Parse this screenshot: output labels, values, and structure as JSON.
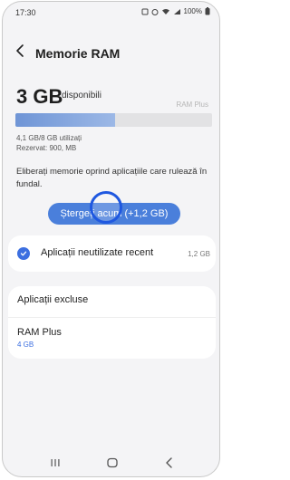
{
  "status": {
    "time": "17:30",
    "battery": "100%"
  },
  "header": {
    "title": "Memorie RAM"
  },
  "ram": {
    "available_value": "3 GB",
    "available_label": "disponibili",
    "ram_plus_label": "RAM Plus",
    "used_fraction": 0.505,
    "used_line": "4,1 GB/8 GB utilizați",
    "reserved_line": "Rezervat: 900, MB"
  },
  "description": "Eliberați memorie oprind aplicațiile care rulează în fundal.",
  "clear_button": {
    "label": "Ștergeți acum (+1,2 GB)"
  },
  "recent_apps": {
    "label": "Aplicații neutilizate recent",
    "size": "1,2 GB",
    "checked": true
  },
  "excluded": {
    "label": "Aplicații excluse"
  },
  "ram_plus": {
    "label": "RAM Plus",
    "value": "4 GB"
  },
  "colors": {
    "accent": "#3c6fe0",
    "button": "#4a7fdb",
    "ring": "#1f58e0"
  },
  "icons": {
    "back": "back-arrow-icon",
    "check": "check-circle-icon",
    "wifi": "wifi-icon",
    "signal": "signal-icon",
    "battery": "battery-icon"
  },
  "navigation": [
    "recent-apps-icon",
    "home-icon",
    "back-icon"
  ]
}
